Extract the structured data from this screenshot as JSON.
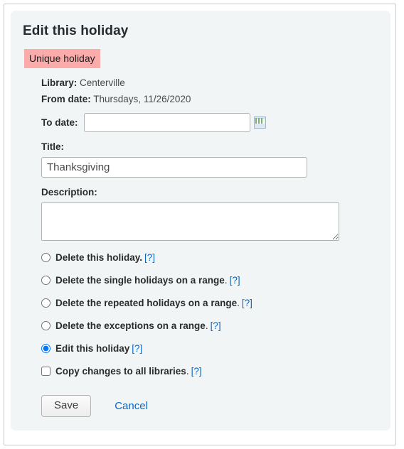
{
  "card": {
    "title": "Edit this holiday",
    "badge": "Unique holiday"
  },
  "details": {
    "library_label": "Library:",
    "library_value": "Centerville",
    "from_date_label": "From date:",
    "from_date_value": "Thursdays, 11/26/2020",
    "to_date_label": "To date:",
    "to_date_value": "",
    "to_date_placeholder": "",
    "calendar_icon": "calendar-icon"
  },
  "form": {
    "title_label": "Title:",
    "title_value": "Thanksgiving",
    "title_placeholder": "",
    "description_label": "Description:",
    "description_value": "",
    "description_placeholder": ""
  },
  "options": [
    {
      "type": "radio",
      "label": "Delete this holiday.",
      "trailing": "",
      "help": "[?]",
      "checked": false,
      "name": "option-delete-this-holiday"
    },
    {
      "type": "radio",
      "label": "Delete the single holidays on a range",
      "trailing": ".",
      "help": "[?]",
      "checked": false,
      "name": "option-delete-single-holidays-range"
    },
    {
      "type": "radio",
      "label": "Delete the repeated holidays on a range",
      "trailing": ".",
      "help": "[?]",
      "checked": false,
      "name": "option-delete-repeated-holidays-range"
    },
    {
      "type": "radio",
      "label": "Delete the exceptions on a range",
      "trailing": ".",
      "help": "[?]",
      "checked": false,
      "name": "option-delete-exceptions-range"
    },
    {
      "type": "radio",
      "label": "Edit this holiday",
      "trailing": "",
      "help": "[?]",
      "checked": true,
      "name": "option-edit-this-holiday"
    },
    {
      "type": "checkbox",
      "label": "Copy changes to all libraries",
      "trailing": ".",
      "help": "[?]",
      "checked": false,
      "name": "option-copy-changes-all-libraries"
    }
  ],
  "actions": {
    "save_label": "Save",
    "cancel_label": "Cancel"
  },
  "colors": {
    "badge_background": "#fcabab",
    "card_background": "#f1f5f6",
    "link": "#0a66c2"
  }
}
